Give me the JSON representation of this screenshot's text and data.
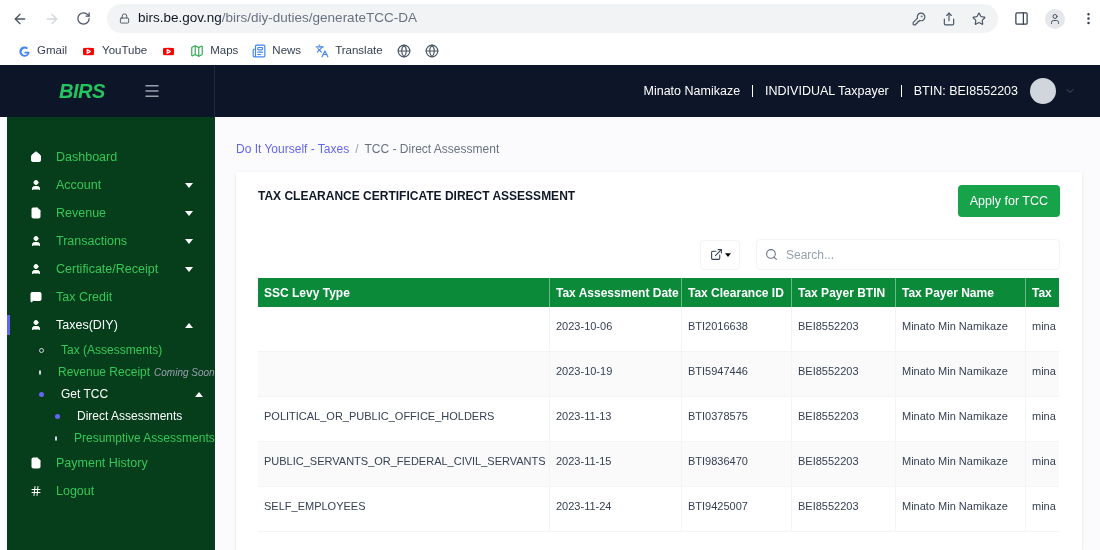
{
  "browser": {
    "url_host": "birs.be.gov.ng",
    "url_path": "/birs/diy-duties/generateTCC-DA"
  },
  "bookmarks": [
    {
      "kind": "google",
      "label": "Gmail"
    },
    {
      "kind": "youtube",
      "label": "YouTube"
    },
    {
      "kind": "youtube"
    },
    {
      "kind": "maps",
      "label": "Maps"
    },
    {
      "kind": "news",
      "label": "News"
    },
    {
      "kind": "translate",
      "label": "Translate"
    },
    {
      "kind": "globe"
    },
    {
      "kind": "globe"
    }
  ],
  "header": {
    "logo": "BIRS",
    "user": "Minato Namikaze",
    "role": "INDIVIDUAL Taxpayer",
    "btin": "BTIN: BEI8552203"
  },
  "sidebar": {
    "items": [
      {
        "label": "Dashboard",
        "selected": false
      },
      {
        "label": "Account",
        "selected": false,
        "expanded": false
      },
      {
        "label": "Revenue",
        "selected": false,
        "expanded": false
      },
      {
        "label": "Transactions",
        "selected": false,
        "expanded": false
      },
      {
        "label": "Certificate/Receipt",
        "selected": false,
        "expanded": false
      },
      {
        "label": "Tax Credit",
        "selected": false
      },
      {
        "label": "Taxes(DIY)",
        "selected": true,
        "expanded": true,
        "children": [
          {
            "label": "Tax (Assessments)",
            "selected": false
          },
          {
            "label": "Revenue Receipt",
            "note": "Coming Soon",
            "selected": false
          },
          {
            "label": "Get TCC",
            "selected": true,
            "expanded": true,
            "children": [
              {
                "label": "Direct Assessments",
                "selected": true
              },
              {
                "label": "Presumptive Assessments",
                "selected": false
              }
            ]
          }
        ]
      },
      {
        "label": "Payment History",
        "selected": false
      },
      {
        "label": "Logout",
        "selected": false
      }
    ]
  },
  "breadcrumb_separator": "/",
  "breadcrumb": [
    {
      "label": "Do It Yourself - Taxes",
      "link": true
    },
    {
      "label": "TCC - Direct Assessment",
      "link": false
    }
  ],
  "card": {
    "title": "TAX CLEARANCE CERTIFICATE DIRECT ASSESSMENT",
    "apply_button": "Apply for TCC",
    "search": {
      "placeholder": "Search..."
    }
  },
  "table": {
    "columns": [
      "SSC Levy Type",
      "Tax Assessment Date",
      "Tax Clearance ID",
      "Tax Payer BTIN",
      "Tax Payer Name",
      "Tax"
    ],
    "rows": [
      [
        "",
        "2023-10-06",
        "BTI2016638",
        "BEI8552203",
        "Minato Min Namikaze",
        "mina"
      ],
      [
        "",
        "2023-10-19",
        "BTI5947446",
        "BEI8552203",
        "Minato Min Namikaze",
        "mina"
      ],
      [
        "POLITICAL_OR_PUBLIC_OFFICE_HOLDERS",
        "2023-11-13",
        "BTI0378575",
        "BEI8552203",
        "Minato Min Namikaze",
        "mina"
      ],
      [
        "PUBLIC_SERVANTS_OR_FEDERAL_CIVIL_SERVANTS",
        "2023-11-15",
        "BTI9836470",
        "BEI8552203",
        "Minato Min Namikaze",
        "mina"
      ],
      [
        "SELF_EMPLOYEES",
        "2023-11-24",
        "BTI9425007",
        "BEI8552203",
        "Minato Min Namikaze",
        "mina"
      ]
    ]
  }
}
